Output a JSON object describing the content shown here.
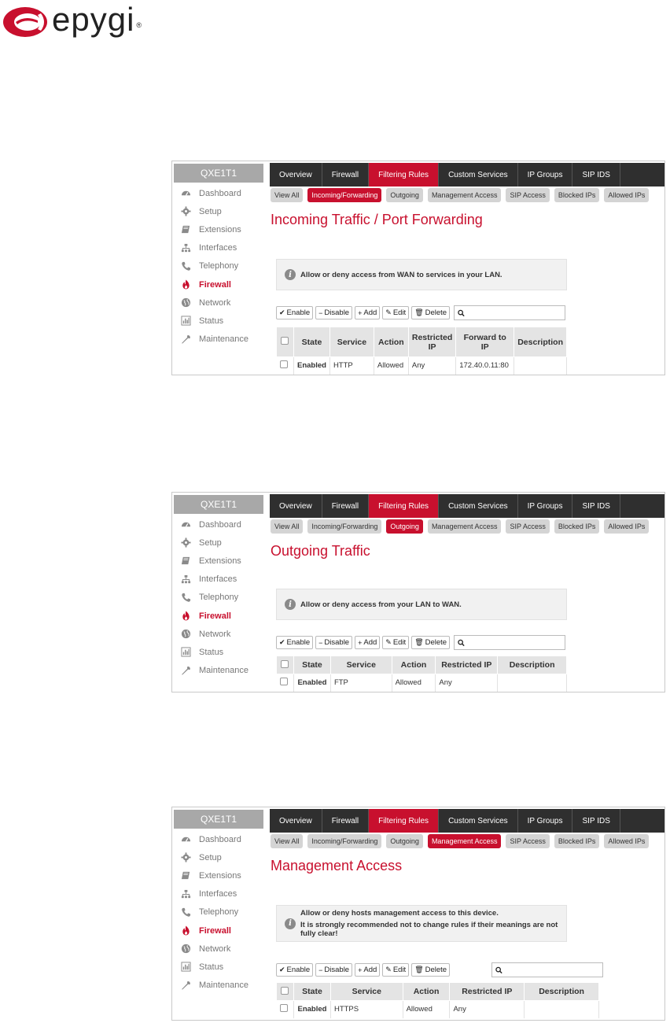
{
  "logo": {
    "text": "epygi",
    "reg": "®"
  },
  "colors": {
    "accent": "#c8102e",
    "nav_dark": "#2f2f2f",
    "device_bar": "#a8a8a8",
    "pill": "#d4d4d4"
  },
  "sidebar": {
    "device": "QXE1T1",
    "items": [
      {
        "label": "Dashboard",
        "icon": "dashboard-icon"
      },
      {
        "label": "Setup",
        "icon": "gear-icon"
      },
      {
        "label": "Extensions",
        "icon": "book-icon"
      },
      {
        "label": "Interfaces",
        "icon": "network-tree-icon"
      },
      {
        "label": "Telephony",
        "icon": "phone-icon"
      },
      {
        "label": "Firewall",
        "icon": "flame-icon",
        "active": true
      },
      {
        "label": "Network",
        "icon": "globe-icon"
      },
      {
        "label": "Status",
        "icon": "bar-chart-icon"
      },
      {
        "label": "Maintenance",
        "icon": "wrench-icon"
      }
    ]
  },
  "topnav": [
    "Overview",
    "Firewall",
    "Filtering Rules",
    "Custom Services",
    "IP Groups",
    "SIP IDS"
  ],
  "topnav_active": "Filtering Rules",
  "subnav": [
    "View All",
    "Incoming/Forwarding",
    "Outgoing",
    "Management Access",
    "SIP Access",
    "Blocked IPs",
    "Allowed IPs"
  ],
  "toolbar": {
    "enable": "Enable",
    "disable": "Disable",
    "add": "Add",
    "edit": "Edit",
    "delete": "Delete",
    "search_placeholder": ""
  },
  "screens": [
    {
      "title": "Incoming Traffic / Port Forwarding",
      "active_sub": "Incoming/Forwarding",
      "info": [
        "Allow or deny access from WAN to services in your LAN."
      ],
      "columns": [
        "State",
        "Service",
        "Action",
        "Restricted IP",
        "Forward to IP",
        "Description"
      ],
      "rows": [
        [
          "Enabled",
          "HTTP",
          "Allowed",
          "Any",
          "172.40.0.11:80",
          ""
        ]
      ]
    },
    {
      "title": "Outgoing Traffic",
      "active_sub": "Outgoing",
      "info": [
        "Allow or deny access from your LAN to WAN."
      ],
      "columns": [
        "State",
        "Service",
        "Action",
        "Restricted IP",
        "Description"
      ],
      "rows": [
        [
          "Enabled",
          "FTP",
          "Allowed",
          "Any",
          ""
        ]
      ]
    },
    {
      "title": "Management Access",
      "active_sub": "Management Access",
      "info": [
        "Allow or deny hosts management access to this device.",
        "It is strongly recommended not to change rules if their meanings are not fully clear!"
      ],
      "columns": [
        "State",
        "Service",
        "Action",
        "Restricted IP",
        "Description"
      ],
      "rows": [
        [
          "Enabled",
          "HTTPS",
          "Allowed",
          "Any",
          ""
        ]
      ]
    }
  ]
}
